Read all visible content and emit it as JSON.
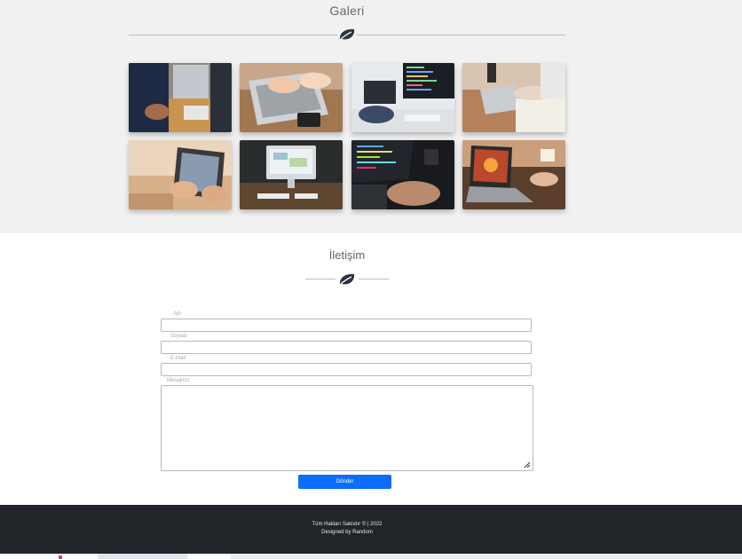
{
  "gallery": {
    "title": "Galeri",
    "images": [
      {
        "label": "team-laptop-desk"
      },
      {
        "label": "hands-typing-laptop"
      },
      {
        "label": "code-monitor-desk"
      },
      {
        "label": "laptop-papers-table"
      },
      {
        "label": "tablet-hands"
      },
      {
        "label": "imac-keyboard"
      },
      {
        "label": "laptop-code-typing"
      },
      {
        "label": "laptop-night-desk"
      }
    ]
  },
  "contact": {
    "title": "İletişim",
    "fields": {
      "name_label": "Adı",
      "surname_label": "Soyadı",
      "email_label": "E-Mail",
      "message_label": "Mesajınız"
    },
    "send_label": "Gönder"
  },
  "footer": {
    "rights": "Tüm Hakları Saklıdır © | 2022",
    "designed": "Designed by Random"
  },
  "colors": {
    "accent": "#0d6efd",
    "footer_bg": "#212529",
    "gallery_bg": "#f1f1f1",
    "leaf": "#2b3340"
  }
}
